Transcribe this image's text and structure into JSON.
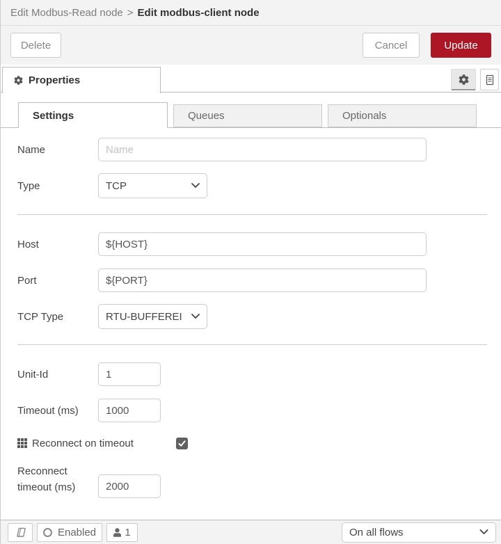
{
  "colors": {
    "accent_red": "#AD1625",
    "header_bg": "#f3f3f3",
    "border": "#cccccc"
  },
  "breadcrumb": {
    "parent": "Edit Modbus-Read node",
    "separator": ">",
    "current": "Edit modbus-client node"
  },
  "toolbar": {
    "delete_label": "Delete",
    "cancel_label": "Cancel",
    "update_label": "Update"
  },
  "panel": {
    "properties_tab_label": "Properties",
    "icons": [
      "gear-icon",
      "gear-icon",
      "document-icon"
    ]
  },
  "tabs": {
    "settings": "Settings",
    "queues": "Queues",
    "optionals": "Optionals",
    "active": "Settings"
  },
  "form": {
    "name": {
      "label": "Name",
      "placeholder": "Name",
      "value": ""
    },
    "type": {
      "label": "Type",
      "value": "TCP"
    },
    "host": {
      "label": "Host",
      "value": "${HOST}"
    },
    "port": {
      "label": "Port",
      "value": "${PORT}"
    },
    "tcp_type": {
      "label": "TCP Type",
      "value": "RTU-BUFFEREI"
    },
    "unit_id": {
      "label": "Unit-Id",
      "value": "1"
    },
    "timeout": {
      "label": "Timeout (ms)",
      "value": "1000"
    },
    "reconnect_on_timeout": {
      "label": "Reconnect on timeout",
      "checked": true,
      "icon": "grid-icon"
    },
    "reconnect_timeout": {
      "label": "Reconnect timeout (ms)",
      "value": "2000"
    }
  },
  "footer": {
    "book_icon": "book-icon",
    "enabled_label": "Enabled",
    "enabled_icon": "circle-icon",
    "instance_icon": "user-icon",
    "instance_count": "1",
    "scope_select": "On all flows"
  }
}
